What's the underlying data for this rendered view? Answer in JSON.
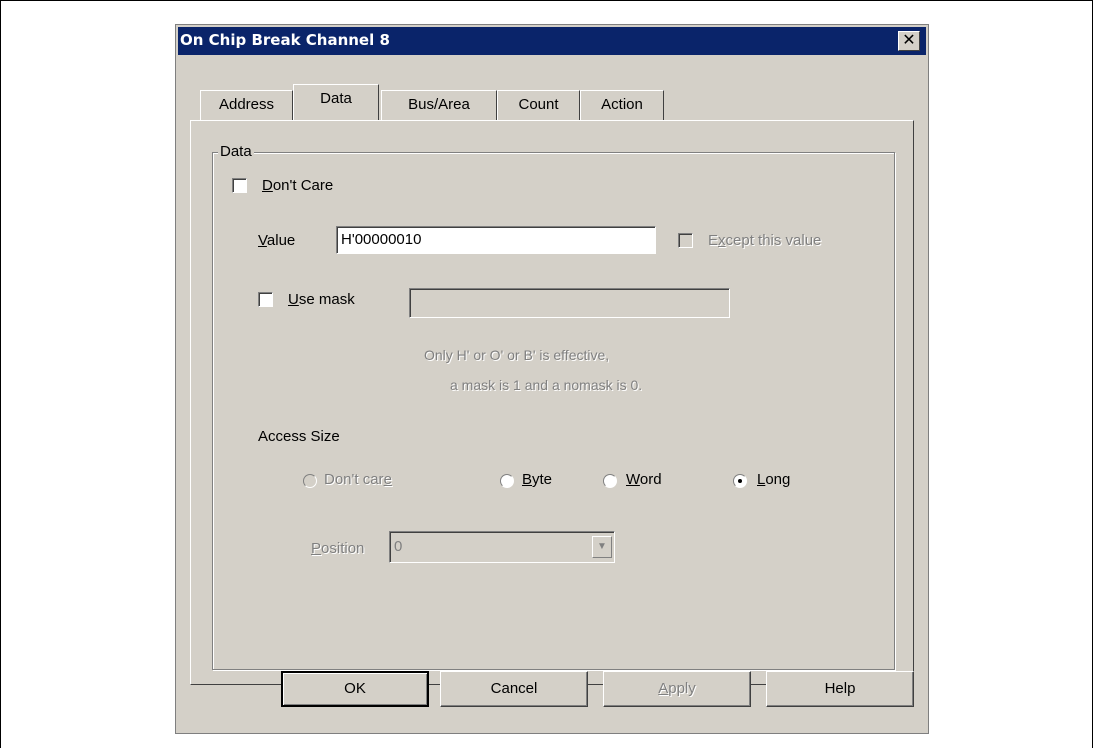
{
  "dialog": {
    "title": "On Chip Break Channel 8",
    "close_glyph": "✕"
  },
  "tabs": [
    {
      "label": "Address"
    },
    {
      "label": "Data"
    },
    {
      "label": "Bus/Area"
    },
    {
      "label": "Count"
    },
    {
      "label": "Action"
    }
  ],
  "data_group": {
    "legend": "Data",
    "dont_care": {
      "label_u": "D",
      "label_rest": "on't Care",
      "checked": false
    },
    "value": {
      "label_u": "V",
      "label_rest": "alue",
      "text": "H'00000010"
    },
    "except": {
      "label_pre": "E",
      "label_u": "x",
      "label_rest": "cept this value",
      "checked": false
    },
    "use_mask": {
      "label_u": "U",
      "label_rest": "se mask",
      "checked": false,
      "text": ""
    },
    "hint_line1": "Only H' or O' or B' is effective,",
    "hint_line2": "a mask is 1 and a nomask is 0.",
    "access_size": {
      "label": "Access Size",
      "options": [
        {
          "label_pre": "Don't car",
          "label_u": "e",
          "label_rest": "",
          "enabled": false
        },
        {
          "label_pre": "",
          "label_u": "B",
          "label_rest": "yte",
          "enabled": true
        },
        {
          "label_pre": "",
          "label_u": "W",
          "label_rest": "ord",
          "enabled": true
        },
        {
          "label_pre": "",
          "label_u": "L",
          "label_rest": "ong",
          "enabled": true
        }
      ],
      "selected": "Long"
    },
    "position": {
      "label_u": "P",
      "label_rest": "osition",
      "value": "0"
    }
  },
  "buttons": {
    "ok": "OK",
    "cancel": "Cancel",
    "apply_u": "A",
    "apply_rest": "pply",
    "help": "Help"
  }
}
